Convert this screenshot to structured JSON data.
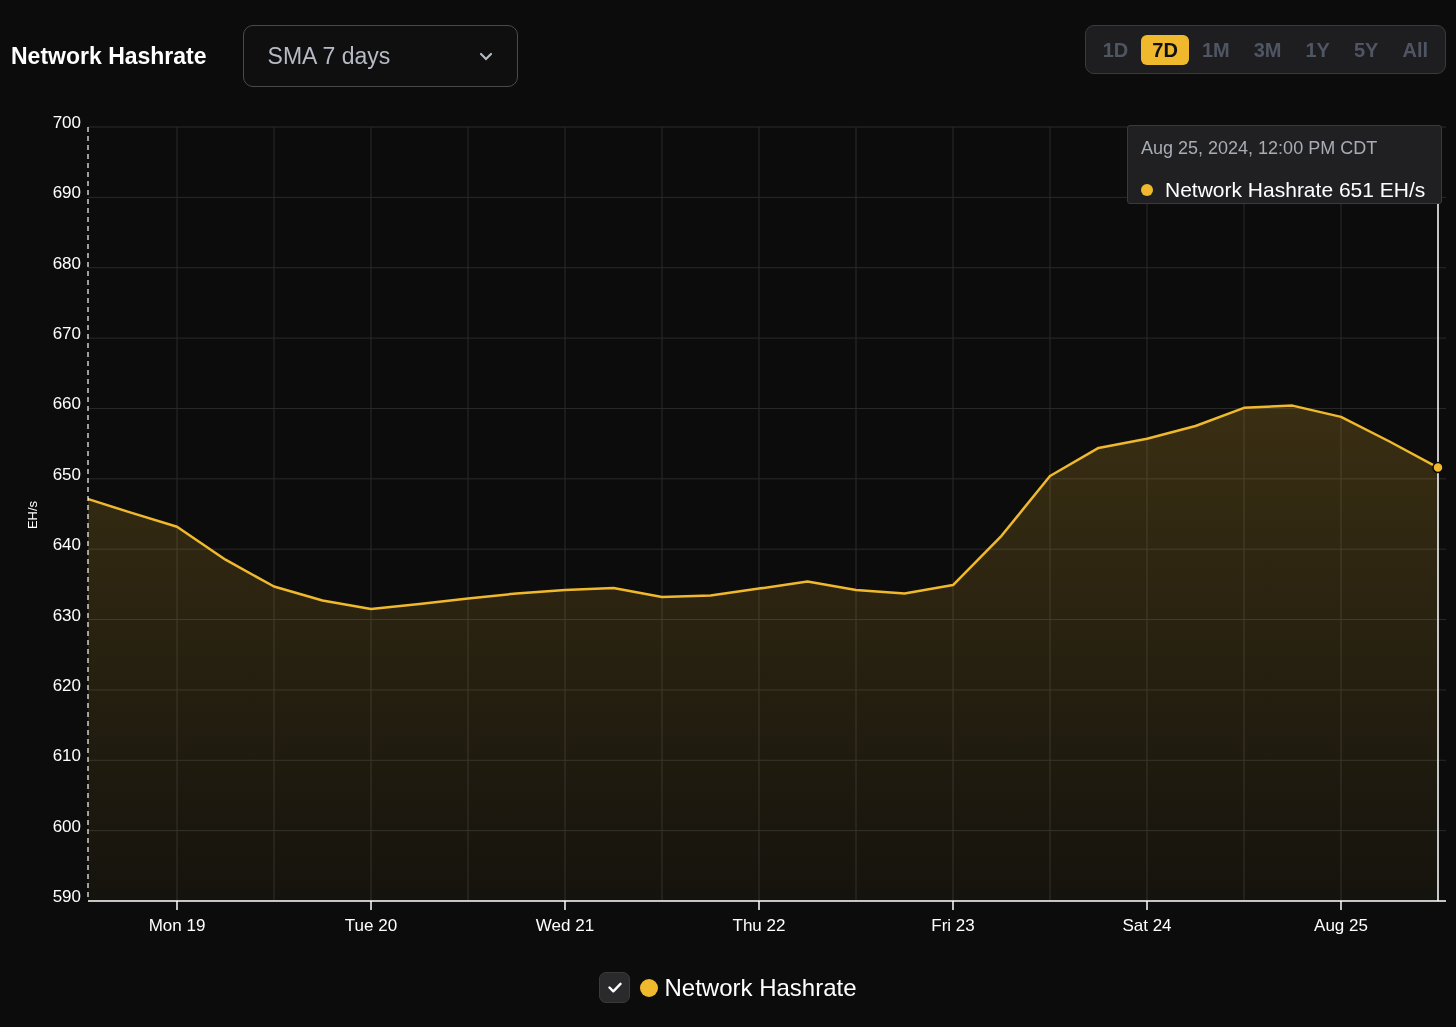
{
  "header": {
    "title": "Network Hashrate",
    "dropdown": {
      "value": "SMA 7 days"
    }
  },
  "ranges": [
    {
      "label": "1D",
      "selected": false
    },
    {
      "label": "7D",
      "selected": true
    },
    {
      "label": "1M",
      "selected": false
    },
    {
      "label": "3M",
      "selected": false
    },
    {
      "label": "1Y",
      "selected": false
    },
    {
      "label": "5Y",
      "selected": false
    },
    {
      "label": "All",
      "selected": false
    }
  ],
  "chart": {
    "tooltip": {
      "time": "Aug 25, 2024, 12:00 PM CDT",
      "text": "Network Hashrate 651 EH/s",
      "color": "#f0b92d"
    },
    "chart_data": {
      "type": "area",
      "grid": true,
      "ylabel": "EH/s",
      "ylim": [
        590,
        700
      ],
      "yticks": [
        590,
        600,
        610,
        620,
        630,
        640,
        650,
        660,
        670,
        680,
        690,
        700
      ],
      "categories": [
        null,
        null,
        "Mon 19",
        null,
        null,
        null,
        "Tue 20",
        null,
        null,
        null,
        "Wed 21",
        null,
        null,
        null,
        "Thu 22",
        null,
        null,
        null,
        "Fri 23",
        null,
        null,
        null,
        "Sat 24",
        null,
        null,
        null,
        "Aug 25",
        null,
        null
      ],
      "series": [
        {
          "name": "Network Hashrate",
          "color": "#f0b92d",
          "values": [
            647.5,
            645.3,
            643.2,
            638.5,
            634.7,
            632.7,
            631.5,
            632.2,
            633,
            633.7,
            634.2,
            634.5,
            633.2,
            633.4,
            634.4,
            635.4,
            634.2,
            633.7,
            634.9,
            641.9,
            650.4,
            654.4,
            655.7,
            657.5,
            660.1,
            660.4,
            658.8,
            655.3,
            651.6
          ]
        }
      ]
    }
  },
  "legend": [
    {
      "checked": true
    }
  ]
}
